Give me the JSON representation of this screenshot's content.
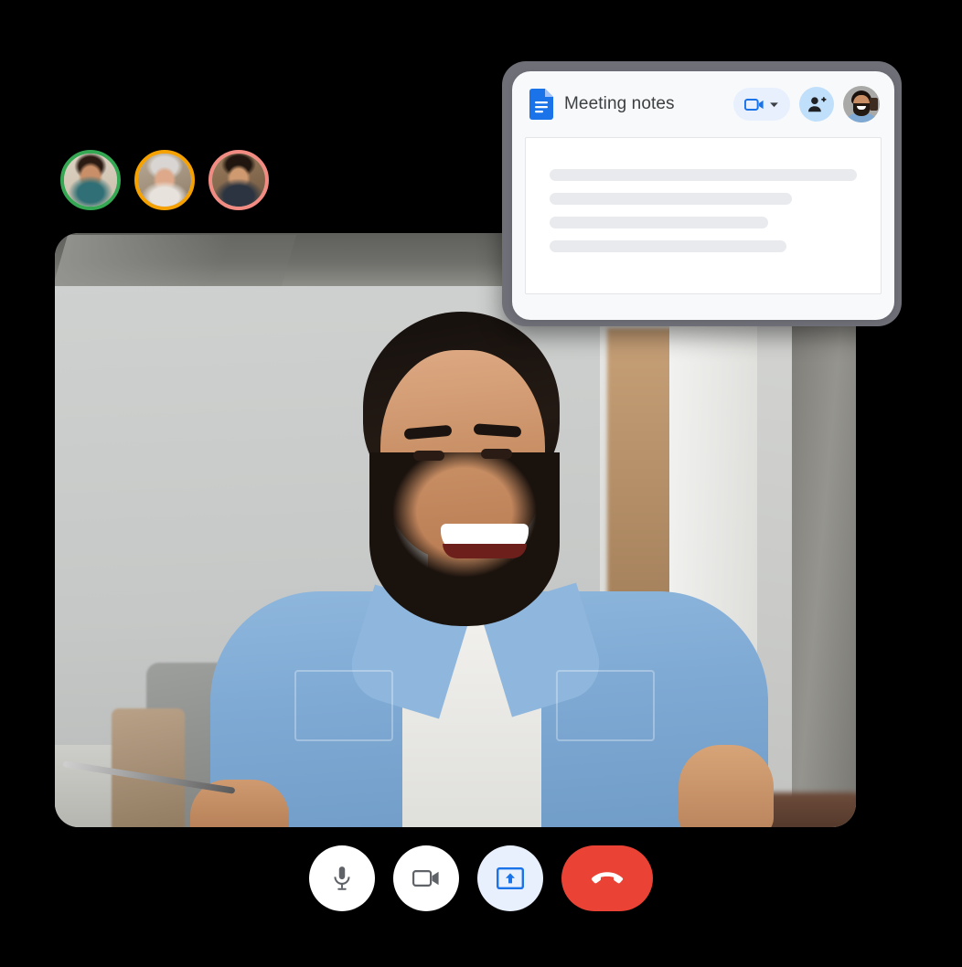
{
  "app": {
    "name": "google-meet-call",
    "background_color": "#000000"
  },
  "participants": {
    "label": "call-participants",
    "avatars": [
      {
        "name": "participant-1",
        "ring_color": "#34a853",
        "photo": "ph-room1"
      },
      {
        "name": "participant-2",
        "ring_color": "#f5a200",
        "photo": "ph-room2"
      },
      {
        "name": "participant-3",
        "ring_color": "#f28b82",
        "photo": "ph-room3"
      }
    ]
  },
  "video": {
    "label": "active-speaker-video",
    "description": "Smiling man in light blue denim shirt over white t-shirt, office room with concrete ceiling, gray wall and open doorway"
  },
  "notes_card": {
    "title": "Meeting notes",
    "doc_icon": "google-docs-icon",
    "frame_color": "#6f6f78",
    "card_color": "#f8f9fa",
    "actions": [
      {
        "name": "present-to-meeting-button",
        "icon": "video-camera-icon",
        "caret": "chevron-down-icon",
        "bg": "#e8f0fe"
      },
      {
        "name": "add-people-button",
        "icon": "person-add-icon",
        "bg": "#bfdffb"
      },
      {
        "name": "account-avatar",
        "icon": "user-avatar",
        "bg": "#a9a9a7"
      }
    ],
    "document": {
      "name": "notes-document-body",
      "placeholder_lines": [
        {
          "width_pct": 100
        },
        {
          "width_pct": 79
        },
        {
          "width_pct": 71
        },
        {
          "width_pct": 77
        }
      ],
      "line_color": "#e8eaed"
    }
  },
  "controls": {
    "label": "meeting-controls",
    "buttons": [
      {
        "name": "microphone-button",
        "icon": "microphone-icon",
        "bg": "#ffffff",
        "fg": "#5f6368",
        "shape": "circle"
      },
      {
        "name": "camera-button",
        "icon": "video-camera-icon",
        "bg": "#ffffff",
        "fg": "#5f6368",
        "shape": "circle"
      },
      {
        "name": "present-screen-button",
        "icon": "present-screen-icon",
        "bg": "#e8f0fe",
        "fg": "#1a73e8",
        "shape": "circle"
      },
      {
        "name": "end-call-button",
        "icon": "call-end-icon",
        "bg": "#ea4335",
        "fg": "#ffffff",
        "shape": "pill"
      }
    ]
  },
  "colors": {
    "google_blue": "#1a73e8",
    "google_red": "#ea4335",
    "google_green": "#34a853",
    "google_yellow": "#f5a200",
    "light_blue_bg": "#e8f0fe",
    "text_dark": "#3c4043",
    "icon_gray": "#5f6368"
  }
}
